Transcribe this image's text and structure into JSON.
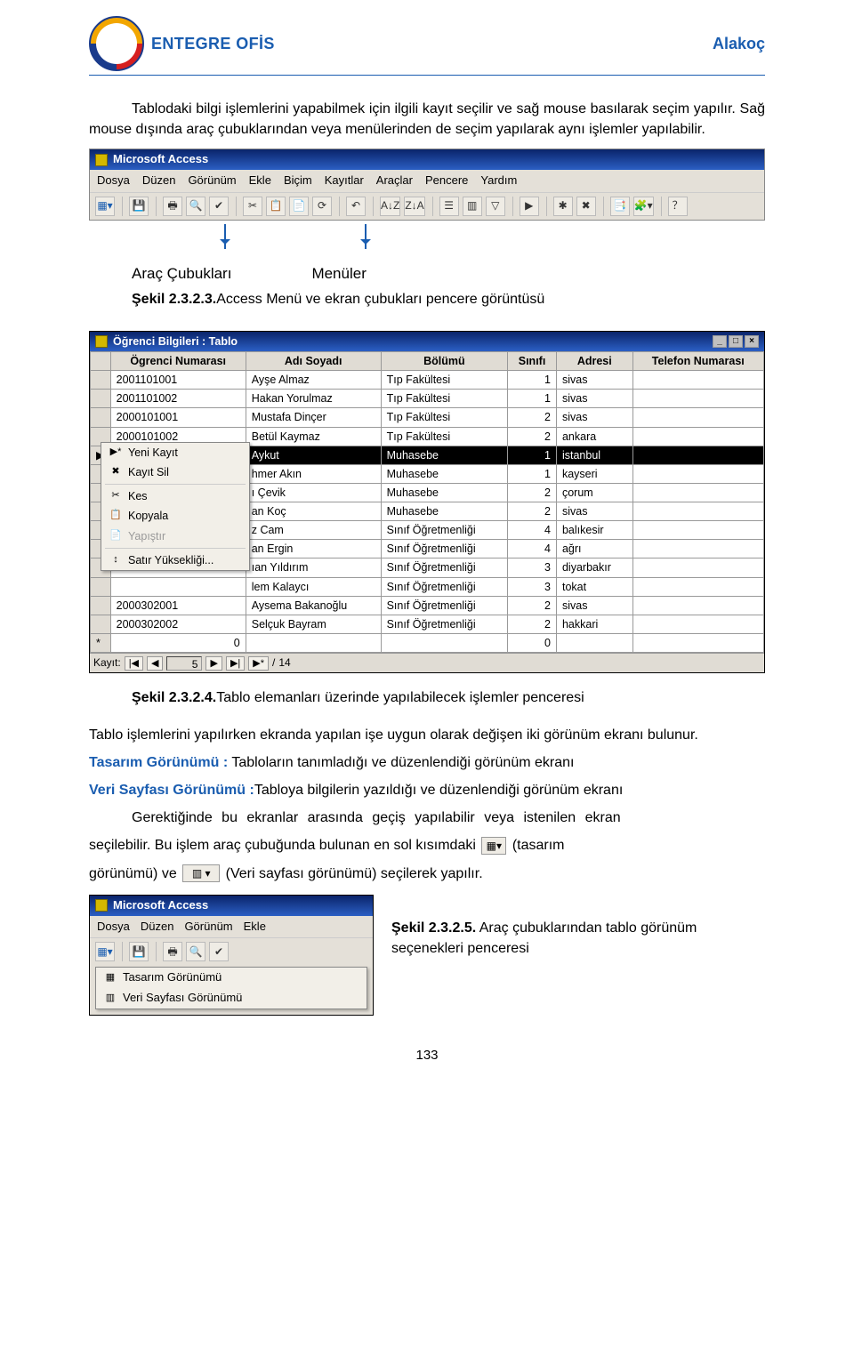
{
  "header": {
    "title_left": "ENTEGRE OFİS",
    "title_right": "Alakoç"
  },
  "intro_paragraph": "Tablodaki bilgi işlemlerini yapabilmek için ilgili kayıt seçilir ve sağ mouse basılarak seçim yapılır. Sağ mouse dışında araç çubuklarından veya menülerinden de seçim yapılarak aynı işlemler yapılabilir.",
  "access_window": {
    "title": "Microsoft Access",
    "menus": [
      "Dosya",
      "Düzen",
      "Görünüm",
      "Ekle",
      "Biçim",
      "Kayıtlar",
      "Araçlar",
      "Pencere",
      "Yardım"
    ],
    "toolbar_icons": [
      "▦▾",
      "💾",
      "🖶",
      "🔍",
      "✔",
      "✂",
      "📋",
      "📄",
      "⟳",
      "↶",
      "A↓Z",
      "Z↓A",
      "☰",
      "▥",
      "▽",
      "▶",
      "✱",
      "✖",
      "📑",
      "🧩▾",
      "？"
    ]
  },
  "arrows": {
    "label_left": "Araç Çubukları",
    "label_right": "Menüler"
  },
  "fig233": {
    "bold": "Şekil 2.3.2.3.",
    "rest": "Access Menü ve ekran çubukları pencere görüntüsü"
  },
  "table_window": {
    "title": "Öğrenci Bilgileri : Tablo",
    "sys_buttons": [
      "_",
      "□",
      "×"
    ],
    "columns": [
      "Ögrenci Numarası",
      "Adı Soyadı",
      "Bölümü",
      "Sınıfı",
      "Adresi",
      "Telefon Numarası"
    ],
    "rows": [
      {
        "no": "2001101001",
        "ad": "Ayşe Almaz",
        "bol": "Tıp Fakültesi",
        "sn": "1",
        "adr": "sivas"
      },
      {
        "no": "2001101002",
        "ad": "Hakan Yorulmaz",
        "bol": "Tıp Fakültesi",
        "sn": "1",
        "adr": "sivas"
      },
      {
        "no": "2000101001",
        "ad": "Mustafa Dinçer",
        "bol": "Tıp Fakültesi",
        "sn": "2",
        "adr": "sivas"
      },
      {
        "no": "2000101002",
        "ad": "Betül Kaymaz",
        "bol": "Tıp Fakültesi",
        "sn": "2",
        "adr": "ankara"
      },
      {
        "no": "",
        "ad": "Aykut",
        "bol": "Muhasebe",
        "sn": "1",
        "adr": "istanbul",
        "selected": true
      },
      {
        "no": "",
        "ad": "hmer Akın",
        "bol": "Muhasebe",
        "sn": "1",
        "adr": "kayseri"
      },
      {
        "no": "",
        "ad": "ı Çevik",
        "bol": "Muhasebe",
        "sn": "2",
        "adr": "çorum"
      },
      {
        "no": "",
        "ad": "an Koç",
        "bol": "Muhasebe",
        "sn": "2",
        "adr": "sivas"
      },
      {
        "no": "",
        "ad": "z Cam",
        "bol": "Sınıf Öğretmenliği",
        "sn": "4",
        "adr": "balıkesir"
      },
      {
        "no": "",
        "ad": "an Ergin",
        "bol": "Sınıf Öğretmenliği",
        "sn": "4",
        "adr": "ağrı"
      },
      {
        "no": "",
        "ad": "ıan Yıldırım",
        "bol": "Sınıf Öğretmenliği",
        "sn": "3",
        "adr": "diyarbakır"
      },
      {
        "no": "",
        "ad": "lem Kalaycı",
        "bol": "Sınıf Öğretmenliği",
        "sn": "3",
        "adr": "tokat"
      },
      {
        "no": "2000302001",
        "ad": "Aysema Bakanoğlu",
        "bol": "Sınıf Öğretmenliği",
        "sn": "2",
        "adr": "sivas"
      },
      {
        "no": "2000302002",
        "ad": "Selçuk Bayram",
        "bol": "Sınıf Öğretmenliği",
        "sn": "2",
        "adr": "hakkari"
      }
    ],
    "blank_row": {
      "no": "0",
      "sn": "0"
    },
    "row_markers": [
      "",
      "",
      "",
      "",
      "▶",
      "",
      "",
      "",
      "",
      "",
      "",
      "",
      "",
      ""
    ],
    "context_menu": [
      {
        "icon": "▶*",
        "label": "Yeni Kayıt"
      },
      {
        "icon": "✖",
        "label": "Kayıt Sil"
      },
      {
        "sep": true
      },
      {
        "icon": "✂",
        "label": "Kes"
      },
      {
        "icon": "📋",
        "label": "Kopyala"
      },
      {
        "icon": "📄",
        "label": "Yapıştır",
        "disabled": true
      },
      {
        "sep": true
      },
      {
        "icon": "↕",
        "label": "Satır Yüksekliği..."
      }
    ],
    "nav": {
      "label": "Kayıt:",
      "value": "5",
      "total": "14",
      "sep": "/"
    }
  },
  "fig234": {
    "bold": "Şekil 2.3.2.4.",
    "rest": "Tablo elemanları üzerinde yapılabilecek işlemler penceresi"
  },
  "para_after_234": "Tablo işlemlerini yapılırken ekranda yapılan işe uygun olarak değişen iki görünüm ekranı bulunur.",
  "design_view": {
    "label": "Tasarım Görünümü :",
    "text": " Tabloların tanımladığı ve düzenlendiği görünüm ekranı"
  },
  "datasheet_view": {
    "label": "Veri Sayfası Görünümü :",
    "text": "Tabloya bilgilerin yazıldığı ve düzenlendiği görünüm ekranı"
  },
  "switch_para_1a": "Gerektiğinde bu ekranlar arasında geçiş yapılabilir veya istenilen ekran",
  "switch_para_1b": "seçilebilir. Bu işlem araç çubuğunda bulunan en sol kısımdaki ",
  "switch_para_1c": "(tasarım",
  "switch_para_2a": "görünümü) ve ",
  "switch_para_2b": " (Veri sayfası görünümü) seçilerek yapılır.",
  "bottom_window": {
    "title": "Microsoft Access",
    "menus": [
      "Dosya",
      "Düzen",
      "Görünüm",
      "Ekle"
    ],
    "toolbar_icons": [
      "▦▾",
      "💾",
      "🖶",
      "🔍",
      "✔"
    ],
    "dropdown": [
      {
        "icon": "▦",
        "label": "Tasarım Görünümü"
      },
      {
        "icon": "▥",
        "label": "Veri Sayfası Görünümü"
      }
    ]
  },
  "fig235": {
    "bold": "Şekil 2.3.2.5.",
    "rest": " Araç çubuklarından tablo görünüm seçenekleri penceresi"
  },
  "page_number": "133"
}
